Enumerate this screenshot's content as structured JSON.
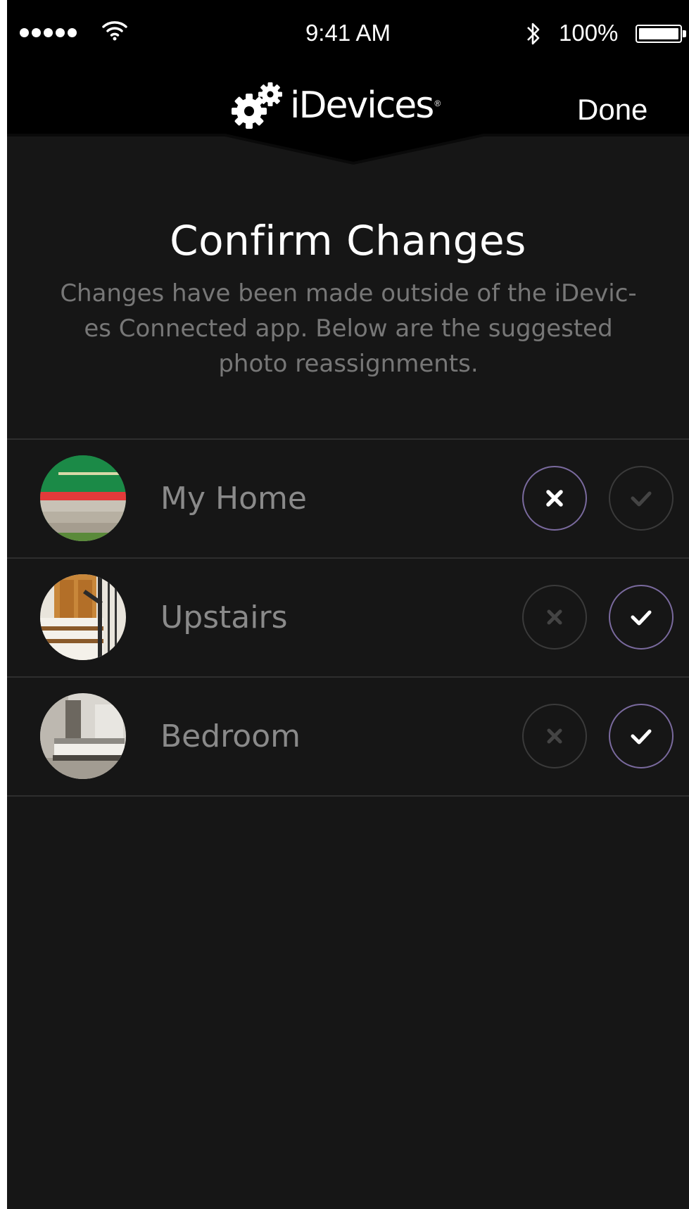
{
  "status_bar": {
    "time": "9:41 AM",
    "battery": "100%",
    "signal_bars": 5,
    "icons": [
      "signal-dots",
      "wifi-icon",
      "bluetooth-icon",
      "battery-icon"
    ]
  },
  "nav": {
    "brand": "iDevices",
    "brand_mark": "®",
    "done_label": "Done"
  },
  "header": {
    "title": "Confirm Changes",
    "subtitle_lines": [
      "Changes have been made outside of the iDevic-",
      "es Connected app. Below are the suggested",
      "photo reassignments."
    ]
  },
  "rows": [
    {
      "label": "My Home",
      "photo": "green-door-entrance",
      "selected": "reject"
    },
    {
      "label": "Upstairs",
      "photo": "wooden-staircase",
      "selected": "accept"
    },
    {
      "label": "Bedroom",
      "photo": "white-bedroom",
      "selected": "accept"
    }
  ],
  "colors": {
    "background": "#161616",
    "bar": "#000000",
    "accent_ring": "#7a6a9e",
    "label": "#8a8a8a",
    "subtitle": "#777777"
  }
}
